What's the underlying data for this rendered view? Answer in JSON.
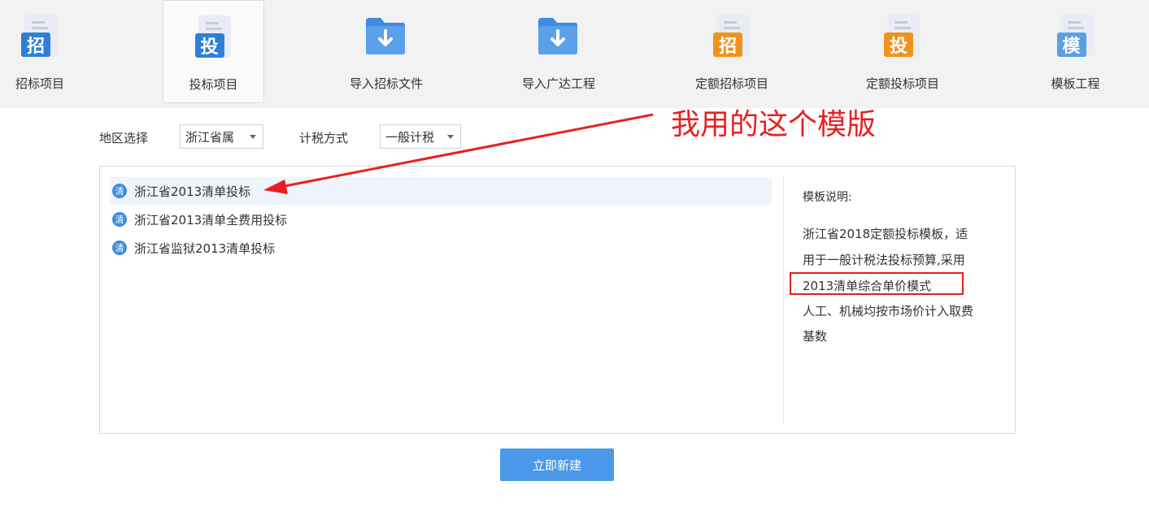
{
  "toolbar": {
    "items": [
      {
        "label": "招标项目",
        "glyph": "招",
        "icon": "doc-badge-icon",
        "color": "#2f7fd9"
      },
      {
        "label": "投标项目",
        "glyph": "投",
        "icon": "doc-badge-icon",
        "color": "#2f7fd9"
      },
      {
        "label": "导入招标文件",
        "icon": "folder-download-icon",
        "color": "#3d8ce0"
      },
      {
        "label": "导入广达工程",
        "icon": "folder-download-icon",
        "color": "#3d8ce0"
      },
      {
        "label": "定额招标项目",
        "glyph": "招",
        "icon": "doc-badge-icon",
        "color": "#f0931e"
      },
      {
        "label": "定额投标项目",
        "glyph": "投",
        "icon": "doc-badge-icon",
        "color": "#f0931e"
      },
      {
        "label": "模板工程",
        "glyph": "模",
        "icon": "doc-badge-icon",
        "color": "#5a9fe6"
      }
    ],
    "active_index": 1
  },
  "filters": {
    "region_label": "地区选择",
    "region_value": "浙江省属",
    "tax_label": "计税方式",
    "tax_value": "一般计税"
  },
  "templates": {
    "badge": "清",
    "items": [
      {
        "label": "浙江省2013清单投标",
        "selected": true
      },
      {
        "label": "浙江省2013清单全费用投标",
        "selected": false
      },
      {
        "label": "浙江省监狱2013清单投标",
        "selected": false
      }
    ]
  },
  "description": {
    "title": "模板说明:",
    "lines": [
      "浙江省2018定额投标模板，适",
      "用于一般计税法投标预算,采用",
      "2013清单综合单价模式",
      "人工、机械均按市场价计入取费",
      "基数"
    ]
  },
  "annotation": {
    "text": "我用的这个模版",
    "color": "#e82020"
  },
  "actions": {
    "create_label": "立即新建"
  },
  "colors": {
    "accent": "#4a98ea",
    "toolbar_bg": "#f2f2f2",
    "selected_row": "#eef5fc"
  }
}
